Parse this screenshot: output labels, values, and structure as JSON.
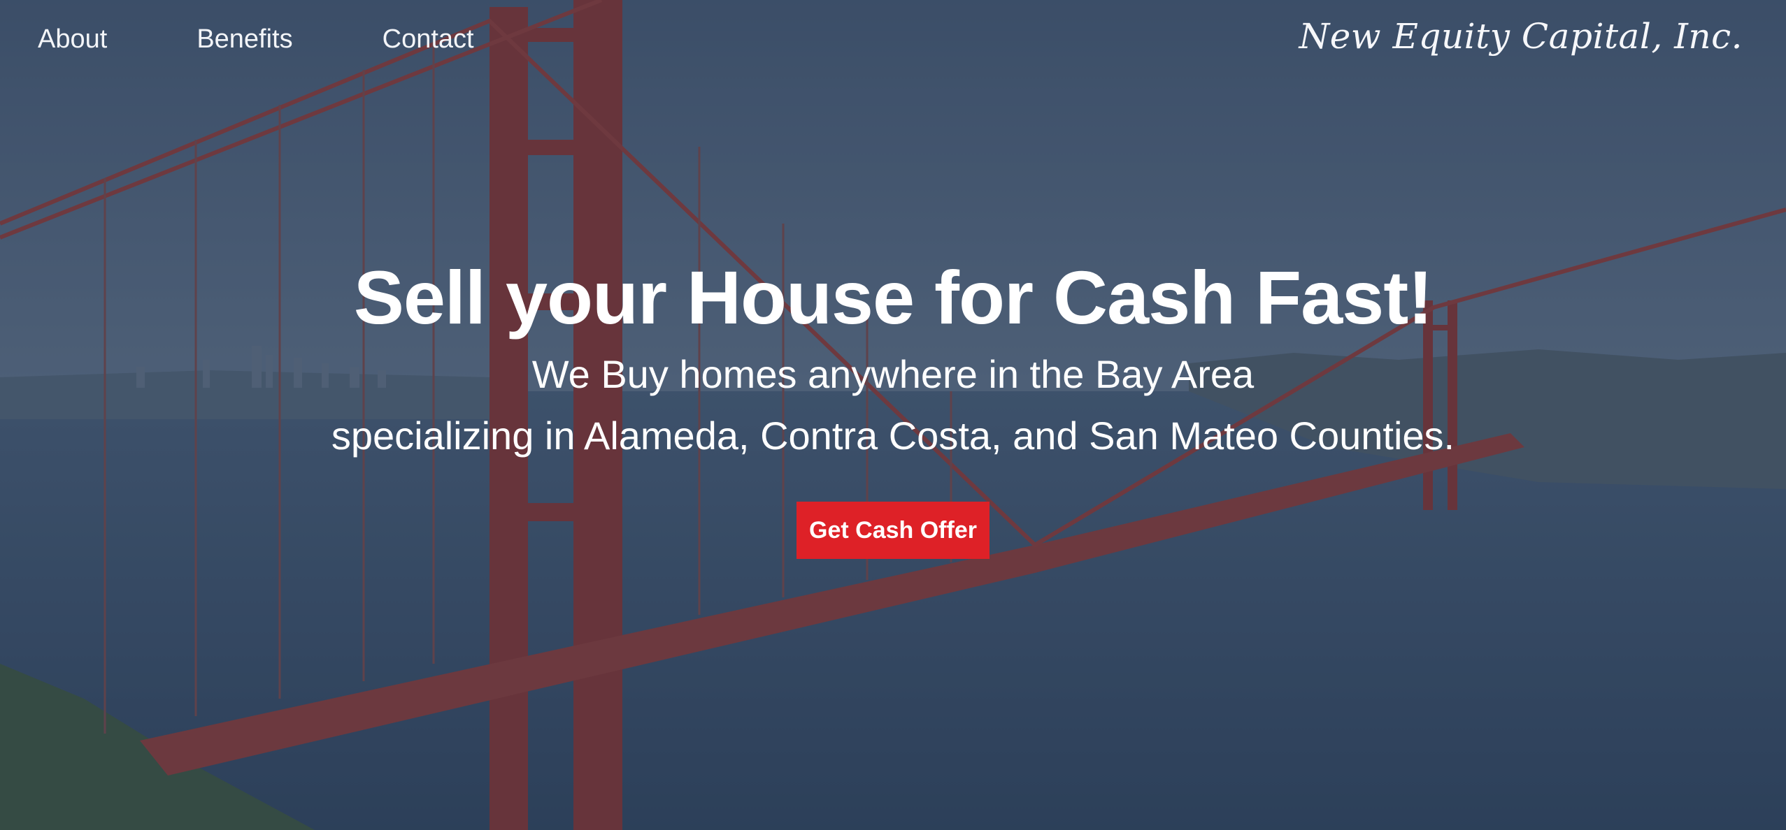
{
  "nav": {
    "items": [
      {
        "label": "About"
      },
      {
        "label": "Benefits"
      },
      {
        "label": "Contact"
      }
    ]
  },
  "brand": {
    "name": "New Equity Capital, Inc."
  },
  "hero": {
    "title": "Sell your House for Cash Fast!",
    "subtitle_line1": "We Buy homes anywhere in the Bay Area",
    "subtitle_line2": "specializing in Alameda, Contra Costa, and San Mateo Counties.",
    "cta_label": "Get Cash Offer"
  },
  "colors": {
    "cta": "#de2127",
    "overlay": "#2b3a52",
    "bridge": "#b23a32"
  },
  "background": {
    "scene": "golden-gate-bridge"
  }
}
